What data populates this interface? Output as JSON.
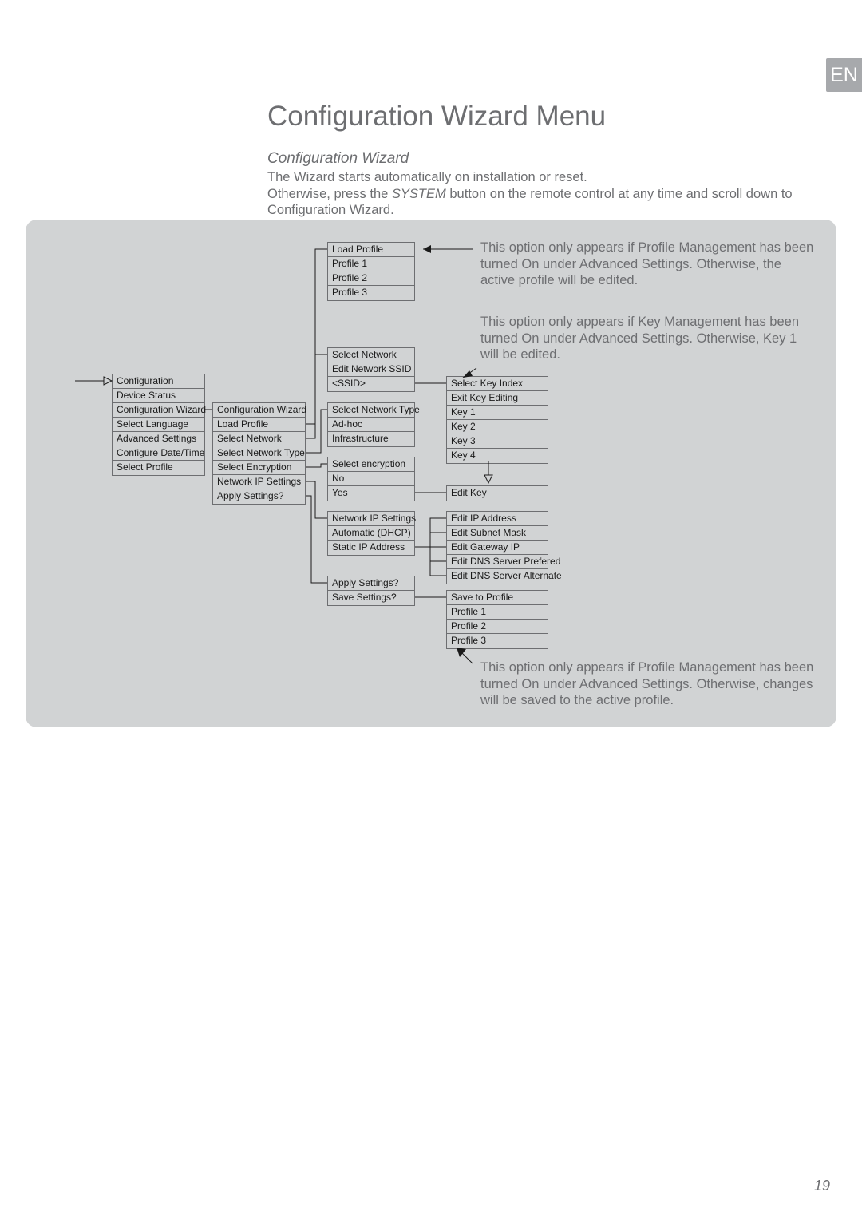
{
  "lang_tab": "EN",
  "title": "Configuration Wizard Menu",
  "subtitle": "Configuration Wizard",
  "intro_line1": "The Wizard starts automatically on installation or reset.",
  "intro_line2a": "Otherwise, press the ",
  "intro_line2b": "SYSTEM",
  "intro_line2c": "    button on the remote control at any time and scroll down to Configuration Wizard.",
  "menu1": [
    "Configuration",
    "Device Status",
    "Configuration Wizard",
    "Select Language",
    "Advanced Settings",
    "Configure Date/Time",
    "Select Profile"
  ],
  "menu2": [
    "Configuration Wizard",
    "Load Profile",
    "Select Network",
    "Select Network Type",
    "Select Encryption",
    "Network IP Settings",
    "Apply Settings?"
  ],
  "load_profile_header": "Load Profile",
  "profiles": [
    "Profile 1",
    "Profile 2",
    "Profile 3"
  ],
  "select_network_header": "Select Network",
  "edit_ssid": "Edit Network SSID",
  "ssid_placeholder": "<SSID>",
  "select_network_type_header": "Select Network Type",
  "adhoc": "Ad-hoc",
  "infra": "Infrastructure",
  "select_encryption_header": "Select encryption",
  "enc_no": "No",
  "enc_yes": "Yes",
  "network_ip_header": "Network IP Settings",
  "dhcp": "Automatic (DHCP)",
  "static_ip": "Static IP Address",
  "apply_settings": "Apply Settings?",
  "save_settings": "Save Settings?",
  "key_index_header": "Select Key Index",
  "exit_key_editing": "Exit Key Editing",
  "keys": [
    "Key 1",
    "Key 2",
    "Key 3",
    "Key 4"
  ],
  "edit_key": "Edit Key",
  "ip_edits": [
    "Edit IP Address",
    "Edit Subnet Mask",
    "Edit Gateway IP",
    "Edit DNS Server Prefered",
    "Edit DNS Server Alternate"
  ],
  "save_to_profile_header": "Save to Profile",
  "save_profiles": [
    "Profile 1",
    "Profile 2",
    "Profile 3"
  ],
  "note_profile_top": "This option only appears if Profile Management has been turned On under Advanced Settings. Otherwise, the active profile will be edited.",
  "note_key": "This option only appears if Key Management has been turned On under Advanced Settings. Otherwise, Key 1 will be edited.",
  "note_profile_bottom": "This option only appears if Profile Management has been turned On under Advanced Settings. Otherwise, changes will be saved to the active profile.",
  "page_number": "19"
}
